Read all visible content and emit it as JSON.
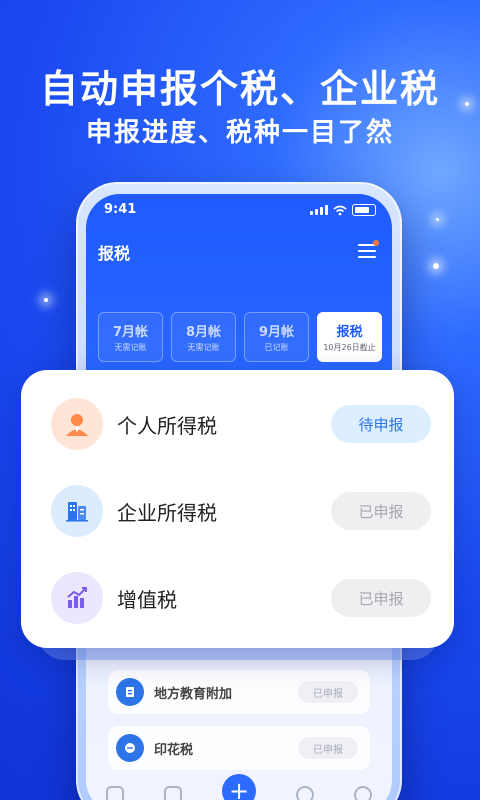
{
  "headline": {
    "title": "自动申报个税、企业税",
    "subtitle": "申报进度、税种一目了然"
  },
  "phone": {
    "status_time": "9:41",
    "app_title": "报税",
    "months": [
      {
        "label": "7月帐",
        "sub": "无需记账"
      },
      {
        "label": "8月帐",
        "sub": "无需记账"
      },
      {
        "label": "9月帐",
        "sub": "已记账"
      },
      {
        "label": "报税",
        "sub": "10月26日截止"
      }
    ],
    "list": [
      {
        "label": "地方教育附加",
        "status": "已申报"
      },
      {
        "label": "印花税",
        "status": "已申报"
      }
    ]
  },
  "card": {
    "rows": [
      {
        "label": "个人所得税",
        "status": "待申报",
        "icon": "person-icon"
      },
      {
        "label": "企业所得税",
        "status": "已申报",
        "icon": "building-icon"
      },
      {
        "label": "增值税",
        "status": "已申报",
        "icon": "chart-icon"
      }
    ]
  },
  "colors": {
    "brand": "#1f5bff",
    "pending_text": "#2c74e8",
    "done_text": "#a6a8b0"
  }
}
